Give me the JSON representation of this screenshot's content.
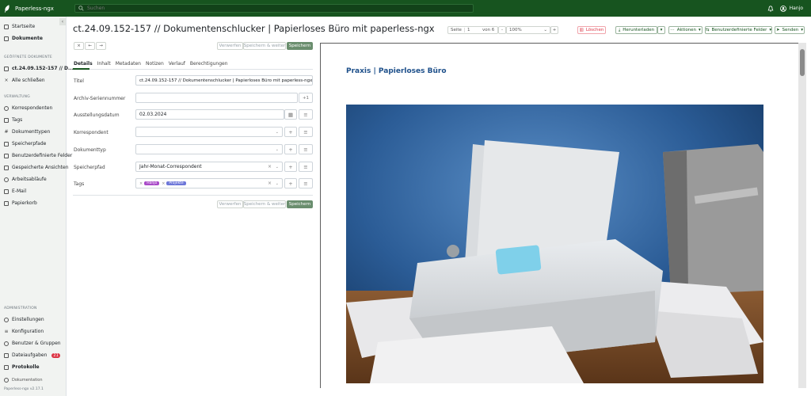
{
  "app": {
    "name": "Paperless-ngx",
    "search_placeholder": "Suchen",
    "user": "Hanjo"
  },
  "sidebar": {
    "top": [
      {
        "label": "Startseite",
        "icon": "house-icon"
      },
      {
        "label": "Dokumente",
        "icon": "file-icon"
      }
    ],
    "open_docs_label": "GEÖFFNETE DOKUMENTE",
    "open_doc": "ct.24.09.152-157 // D...",
    "close_all": "Alle schließen",
    "manage_label": "VERWALTUNG",
    "manage": [
      {
        "label": "Korrespondenten",
        "icon": "person-icon"
      },
      {
        "label": "Tags",
        "icon": "tag-icon"
      },
      {
        "label": "Dokumenttypen",
        "icon": "hash-icon"
      },
      {
        "label": "Speicherpfade",
        "icon": "folder-icon"
      },
      {
        "label": "Benutzerdefinierte Felder",
        "icon": "fields-icon"
      },
      {
        "label": "Gespeicherte Ansichten",
        "icon": "views-icon"
      },
      {
        "label": "Arbeitsabläufe",
        "icon": "workflow-icon"
      },
      {
        "label": "E-Mail",
        "icon": "mail-icon"
      },
      {
        "label": "Papierkorb",
        "icon": "trash-icon"
      }
    ],
    "admin_label": "ADMINISTRATION",
    "admin": [
      {
        "label": "Einstellungen",
        "icon": "gear-icon"
      },
      {
        "label": "Konfiguration",
        "icon": "sliders-icon"
      },
      {
        "label": "Benutzer & Gruppen",
        "icon": "people-icon"
      },
      {
        "label": "Dateiaufgaben",
        "icon": "tasks-icon",
        "badge": "21"
      },
      {
        "label": "Protokolle",
        "icon": "log-icon"
      }
    ],
    "documentation": "Dokumentation",
    "version": "Paperless-ngx v2.17.1"
  },
  "document": {
    "title": "ct.24.09.152-157 // Dokumentenschlucker | Papierloses Büro mit paperless-ngx"
  },
  "toolbar": {
    "page_label": "Seite",
    "page": "1",
    "of_label": "von 6",
    "zoom": "100%",
    "delete": "Löschen",
    "download": "Herunterladen",
    "actions": "Aktionen",
    "custom_fields": "Benutzerdefinierte Felder",
    "send": "Senden"
  },
  "form_actions": {
    "discard": "Verwerfen",
    "save_next": "Speichern & weiter",
    "save": "Speichern"
  },
  "tabs": [
    "Details",
    "Inhalt",
    "Metadaten",
    "Notizen",
    "Verlauf",
    "Berechtigungen"
  ],
  "fields": {
    "title": {
      "label": "Titel",
      "value": "ct.24.09.152-157 // Dokumentenschlucker | Papierloses Büro mit paperless-ngx"
    },
    "asn": {
      "label": "Archiv-Seriennummer",
      "value": "",
      "increment": "+1"
    },
    "date": {
      "label": "Ausstellungsdatum",
      "value": "02.03.2024"
    },
    "correspondent": {
      "label": "Korrespondent",
      "value": ""
    },
    "doctype": {
      "label": "Dokumenttyp",
      "value": ""
    },
    "storage_path": {
      "label": "Speicherpfad",
      "value": "Jahr-Monat-Correspondent"
    },
    "tags": {
      "label": "Tags",
      "items": [
        {
          "name": "Hanjo",
          "color": "#a94bc8"
        },
        {
          "name": "Projekte",
          "color": "#6d77d9"
        }
      ]
    }
  },
  "preview": {
    "header": "Praxis  |  Papierloses Büro"
  }
}
